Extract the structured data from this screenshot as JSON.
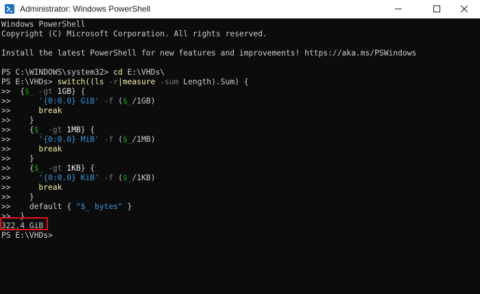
{
  "window": {
    "title": "Administrator: Windows PowerShell",
    "icon": "powershell-icon"
  },
  "console": {
    "header": {
      "l1": "Windows PowerShell",
      "l2": "Copyright (C) Microsoft Corporation. All rights reserved.",
      "l3": "Install the latest PowerShell for new features and improvements! https://aka.ms/PSWindows"
    },
    "prompt1": {
      "prompt": "PS C:\\WINDOWS\\system32> ",
      "cmd": "cd",
      "arg": " E:\\VHDs\\"
    },
    "prompt2": {
      "prompt": "PS E:\\VHDs> ",
      "t1": "switch((ls ",
      "t2": "-r",
      "t3": "|measure ",
      "t4": "-sum",
      "t5": " Length).Sum) {"
    },
    "cont": ">>",
    "block1": {
      "open_a": "  {",
      "var": "$_",
      "op": " -gt ",
      "num": "1GB",
      "open_b": "} {",
      "fmt": "'{0:0.0} GiB'",
      "f": " -f ",
      "expr_a": "(",
      "expr_var": "$_",
      "expr_b": "/1GB)",
      "brk": "break",
      "close": "}"
    },
    "block2": {
      "open_a": "{",
      "var": "$_",
      "op": " -gt ",
      "num": "1MB",
      "open_b": "} {",
      "fmt": "'{0:0.0} MiB'",
      "f": " -f ",
      "expr_a": "(",
      "expr_var": "$_",
      "expr_b": "/1MB)",
      "brk": "break",
      "close": "}"
    },
    "block3": {
      "open_a": "{",
      "var": "$_",
      "op": " -gt ",
      "num": "1KB",
      "open_b": "} {",
      "fmt": "'{0:0.0} KiB'",
      "f": " -f ",
      "expr_a": "(",
      "expr_var": "$_",
      "expr_b": "/1KB)",
      "brk": "break",
      "close": "}"
    },
    "default_line": {
      "kw": "default { ",
      "str": "\"$_ bytes\"",
      "end": " }"
    },
    "final_close": "}",
    "result": "322.4 GiB",
    "last_prompt": "PS E:\\VHDs>"
  },
  "colors": {
    "text": "#cccccc",
    "command": "#f9f1a5",
    "string": "#3a96dd",
    "variable": "#13a10e",
    "operator": "#7a7a7a",
    "highlight": "#e81123"
  }
}
